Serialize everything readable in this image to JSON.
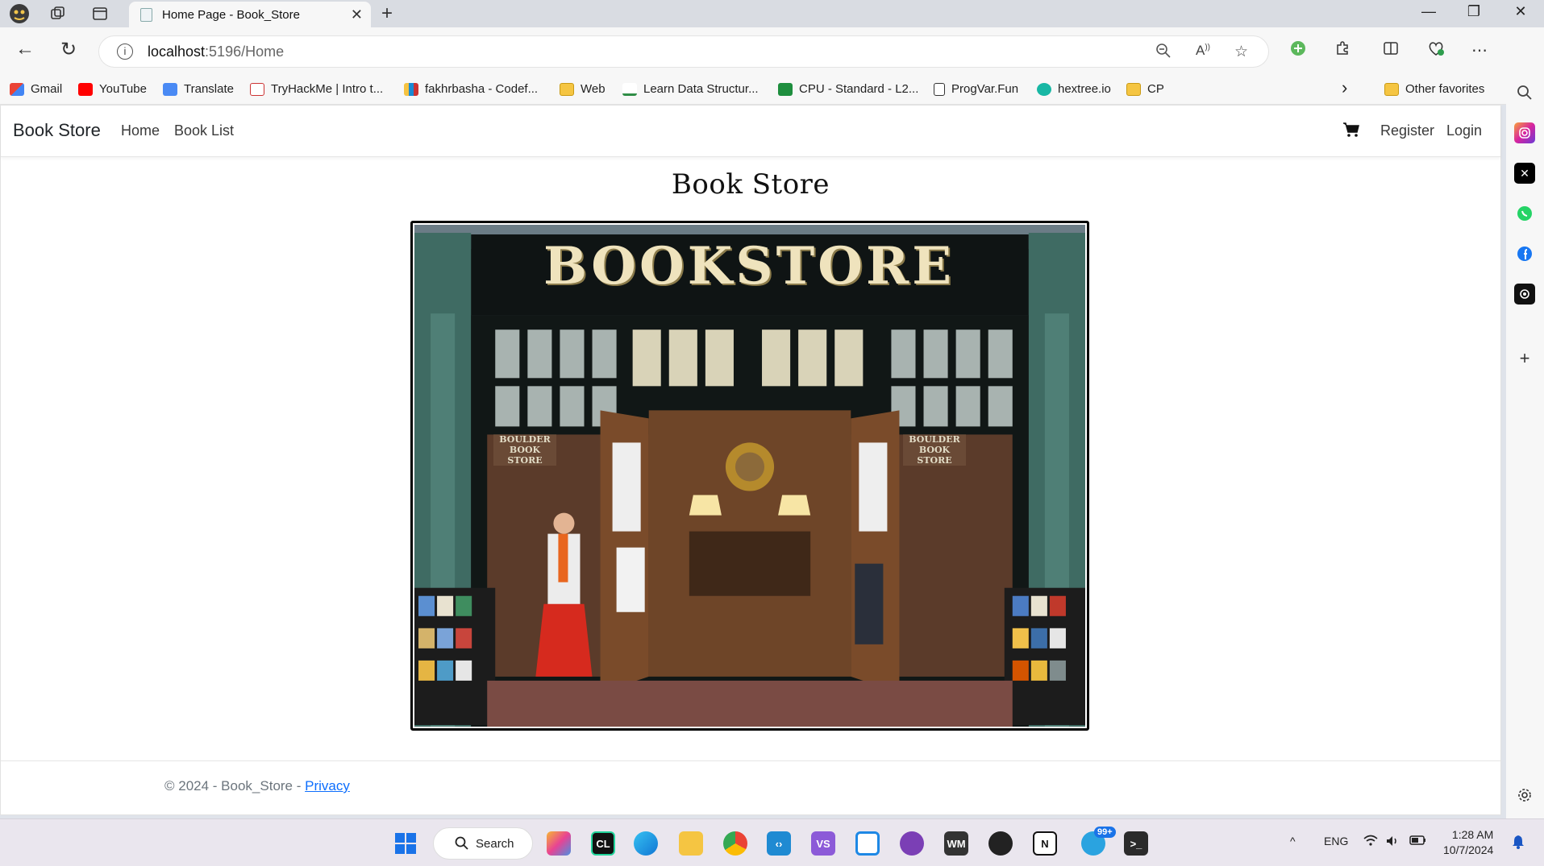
{
  "browser": {
    "tab": {
      "title": "Home Page - Book_Store",
      "close": "✕"
    },
    "new_tab": "+",
    "window": {
      "minimize": "—",
      "restore": "❐",
      "close": "✕"
    },
    "address": {
      "host": "localhost",
      "path": ":5196/Home"
    },
    "nav": {
      "back": "←",
      "reload": "↻"
    },
    "bookmarks": [
      {
        "label": "Gmail"
      },
      {
        "label": "YouTube"
      },
      {
        "label": "Translate"
      },
      {
        "label": "TryHackMe | Intro t..."
      },
      {
        "label": "fakhrbasha - Codef..."
      },
      {
        "label": "Web"
      },
      {
        "label": "Learn Data Structur..."
      },
      {
        "label": "CPU - Standard - L2..."
      },
      {
        "label": "ProgVar.Fun"
      },
      {
        "label": "hextree.io"
      },
      {
        "label": "CP"
      }
    ],
    "bookmarks_more": "›",
    "other_favorites": "Other favorites"
  },
  "site": {
    "brand": "Book Store",
    "nav": {
      "home": "Home",
      "book_list": "Book List",
      "register": "Register",
      "login": "Login"
    },
    "hero_title": "Book Store",
    "store_sign": "BOOKSTORE",
    "door_sign_left": "BOULDER BOOK STORE",
    "door_sign_right": "BOULDER BOOK STORE",
    "footer": {
      "copyright": "© 2024 - Book_Store - ",
      "privacy": "Privacy"
    }
  },
  "taskbar": {
    "search": "Search",
    "badge": "99+",
    "lang": "ENG",
    "time": "1:28 AM",
    "date": "10/7/2024",
    "chevron": "^"
  },
  "colors": {
    "accent": "#0d6efd",
    "footer_text": "#6c757d",
    "teal_facade": "#3f6b63"
  }
}
